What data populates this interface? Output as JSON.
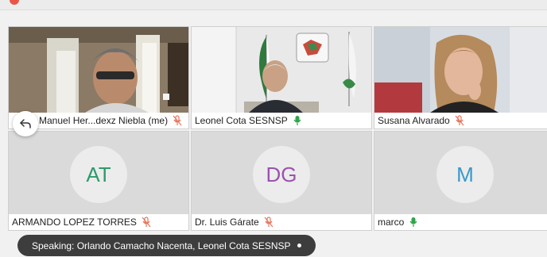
{
  "participants": [
    {
      "name": "Manuel Her...dexz Niebla (me)",
      "mic": "muted"
    },
    {
      "name": "Leonel Cota SESNSP",
      "mic": "active"
    },
    {
      "name": "Susana Alvarado",
      "mic": "muted"
    },
    {
      "name": "ARMANDO LOPEZ TORRES",
      "mic": "muted",
      "initials": "AT",
      "initials_color": "#2e9a6b"
    },
    {
      "name": "Dr. Luis Gárate",
      "mic": "muted",
      "initials": "DG",
      "initials_color": "#9b52b0"
    },
    {
      "name": "marco",
      "mic": "active",
      "initials": "M",
      "initials_color": "#3a98c9"
    }
  ],
  "speaking_banner": "Speaking: Orlando Camacho Nacenta, Leonel Cota SESNSP",
  "colors": {
    "muted_mic": "#e6735c",
    "active_mic": "#2fa54a",
    "banner_bg": "#3d3d3d"
  },
  "icons": {
    "back": "arrow-back-icon",
    "muted_mic": "mic-off-icon",
    "active_mic": "mic-on-icon"
  }
}
